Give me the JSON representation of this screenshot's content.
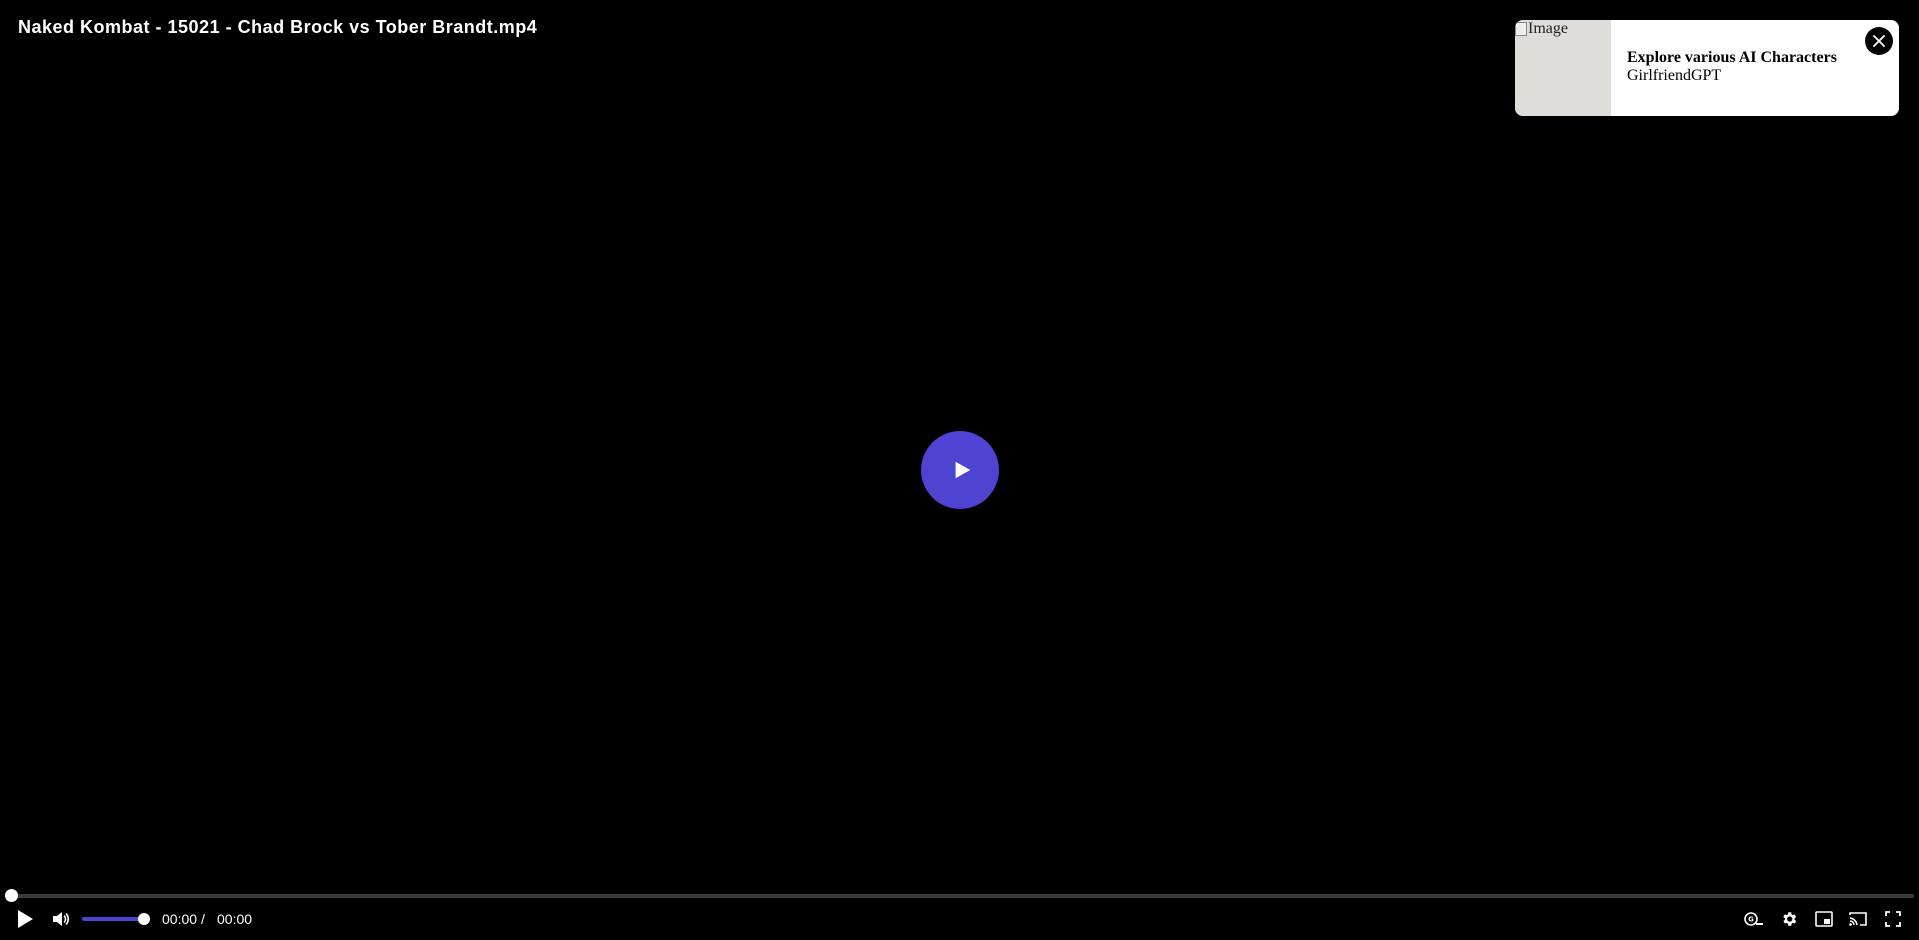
{
  "video": {
    "title": "Naked Kombat - 15021 - Chad Brock vs Tober Brandt.mp4",
    "accent_color": "#4f43d1"
  },
  "ad": {
    "image_alt": "Image",
    "headline": "Explore various AI Characters",
    "brand": "GirlfriendGPT"
  },
  "controls": {
    "current_time": "00:00",
    "separator": "/",
    "duration": "00:00",
    "progress_fraction": 0,
    "volume_fraction": 1,
    "icons": [
      "play-icon",
      "volume-icon",
      "captions-icon",
      "settings-icon",
      "picture-in-picture-icon",
      "cast-icon",
      "fullscreen-icon"
    ]
  }
}
